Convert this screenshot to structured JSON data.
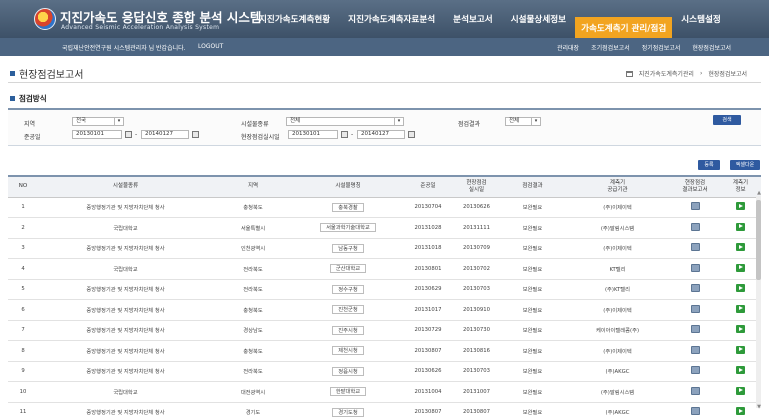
{
  "brand": {
    "title": "지진가속도 응답신호 종합 분석 시스템",
    "subtitle": "Advanced Seismic Acceleration Analysis System"
  },
  "main_nav": [
    "지진가속도계측현황",
    "지진가속도계측자료분석",
    "분석보고서",
    "시설물상세정보",
    "가속도계측기 관리/점검",
    "시스템설정"
  ],
  "active_tab": "가속도계측기 관리/점검",
  "welcome": "국립재난안전연구원 시스템관리자 님 반갑습니다.",
  "logout": "LOGOUT",
  "sub_nav": [
    "관리대장",
    "조기점검보고서",
    "정기점검보고서",
    "현장점검보고서"
  ],
  "page_title": "현장점검보고서",
  "breadcrumb": [
    "지진가속도계측기관리",
    "현장점검보고서"
  ],
  "section_title": "점검방식",
  "filter": {
    "region_label": "지역",
    "region_value": "전국",
    "facility_type_label": "시설물종류",
    "facility_type_value": "전체",
    "result_label": "점검결과",
    "result_value": "전체",
    "date_label": "준공일",
    "date_from": "20130101",
    "date_to": "20140127",
    "inspect_label": "현장점검실시일",
    "inspect_from": "20130101",
    "inspect_to": "20140127",
    "search_button": "검색",
    "add_button": "등록",
    "excel_button": "엑셀다운"
  },
  "table": {
    "headers": [
      "NO",
      "시설물종류",
      "지역",
      "시설물명칭",
      "준공일",
      "현장점검\n실시일",
      "점검결과",
      "계측기\n공급기관",
      "현장점검\n결과보고서",
      "계측기\n정보"
    ],
    "rows": [
      {
        "no": "1",
        "type": "중앙행정기관 및 지방자치단체 청사",
        "region": "충청북도",
        "name": "충북경찰",
        "date": "20130704",
        "inspect": "20130626",
        "result": "보완필요",
        "supplier": "(주)이제이텍"
      },
      {
        "no": "2",
        "type": "국립대학교",
        "region": "서울특별시",
        "name": "서울과학기술대학교",
        "date": "20131028",
        "inspect": "20131111",
        "result": "보완필요",
        "supplier": "(주)말림시스템"
      },
      {
        "no": "3",
        "type": "중앙행정기관 및 지방자치단체 청사",
        "region": "인천광역시",
        "name": "남동구청",
        "date": "20131018",
        "inspect": "20130709",
        "result": "보완필요",
        "supplier": "(주)이제이텍"
      },
      {
        "no": "4",
        "type": "국립대학교",
        "region": "전라북도",
        "name": "군산대학교",
        "date": "20130801",
        "inspect": "20130702",
        "result": "보완필요",
        "supplier": "KT텔리"
      },
      {
        "no": "5",
        "type": "중앙행정기관 및 지방자치단체 청사",
        "region": "전라북도",
        "name": "정수구청",
        "date": "20130629",
        "inspect": "20130703",
        "result": "보완필요",
        "supplier": "(주)KT텔리"
      },
      {
        "no": "6",
        "type": "중앙행정기관 및 지방자치단체 청사",
        "region": "충청북도",
        "name": "진천군청",
        "date": "20131017",
        "inspect": "20130910",
        "result": "보완필요",
        "supplier": "(주)이제이텍"
      },
      {
        "no": "7",
        "type": "중앙행정기관 및 지방자치단체 청사",
        "region": "경상남도",
        "name": "진주시청",
        "date": "20130729",
        "inspect": "20130730",
        "result": "보완필요",
        "supplier": "케이아이텔레콤(주)"
      },
      {
        "no": "8",
        "type": "중앙행정기관 및 지방자치단체 청사",
        "region": "충청북도",
        "name": "제천시청",
        "date": "20130807",
        "inspect": "20130816",
        "result": "보완필요",
        "supplier": "(주)이제이텍"
      },
      {
        "no": "9",
        "type": "중앙행정기관 및 지방자치단체 청사",
        "region": "전라북도",
        "name": "정읍시청",
        "date": "20130626",
        "inspect": "20130703",
        "result": "보완필요",
        "supplier": "(주)AKGC"
      },
      {
        "no": "10",
        "type": "국립대학교",
        "region": "대전광역시",
        "name": "한밭대학교",
        "date": "20131004",
        "inspect": "20131007",
        "result": "보완필요",
        "supplier": "(주)말림시스템"
      },
      {
        "no": "11",
        "type": "중앙행정기관 및 지방자치단체 청사",
        "region": "경기도",
        "name": "경기도청",
        "date": "20130807",
        "inspect": "20130807",
        "result": "보완필요",
        "supplier": "(주)AKGC"
      }
    ]
  }
}
